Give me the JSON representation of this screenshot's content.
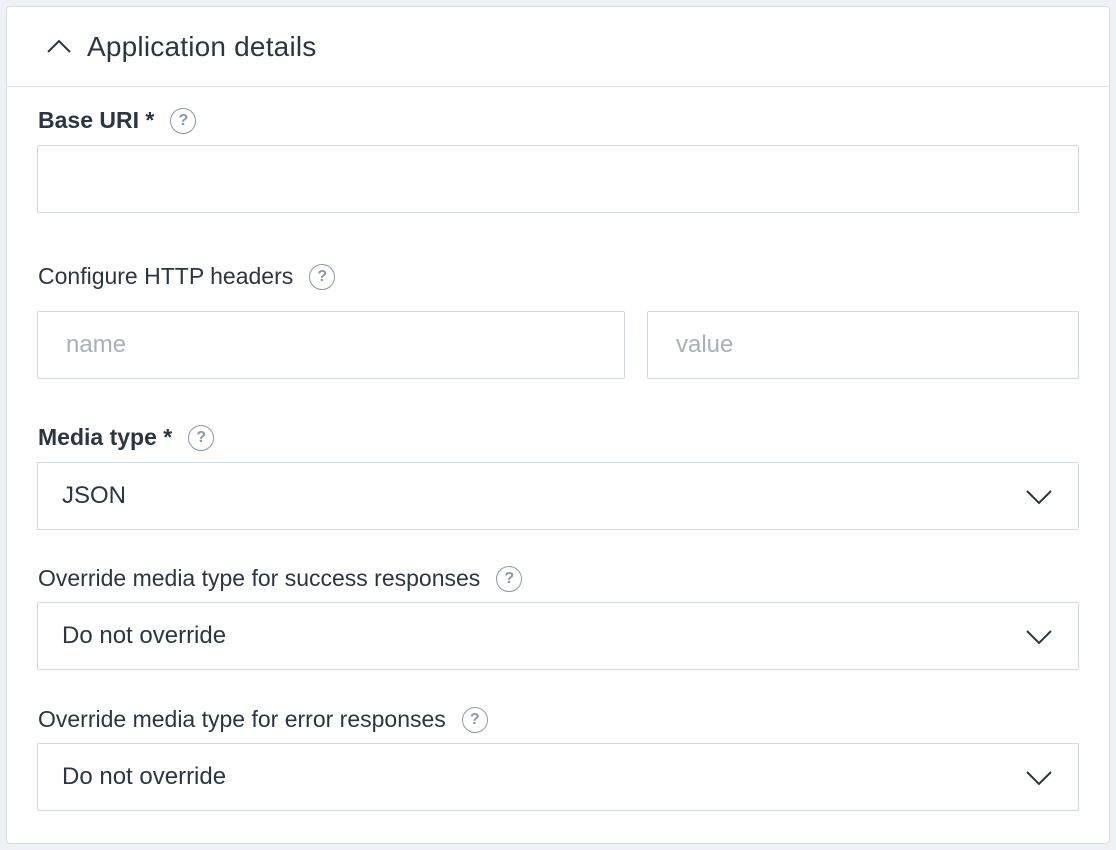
{
  "section": {
    "title": "Application details",
    "expanded": true
  },
  "base_uri": {
    "label": "Base URI *",
    "value": ""
  },
  "http_headers": {
    "label": "Configure HTTP headers",
    "name_placeholder": "name",
    "value_placeholder": "value"
  },
  "media_type": {
    "label": "Media type *",
    "selected": "JSON"
  },
  "success_override": {
    "label": "Override media type for success responses",
    "selected": "Do not override"
  },
  "error_override": {
    "label": "Override media type for error responses",
    "selected": "Do not override"
  },
  "icons": {
    "collapse": "chevron-up-icon",
    "help": "question-circle-icon",
    "dropdown": "chevron-down-icon"
  },
  "help_glyph": "?"
}
